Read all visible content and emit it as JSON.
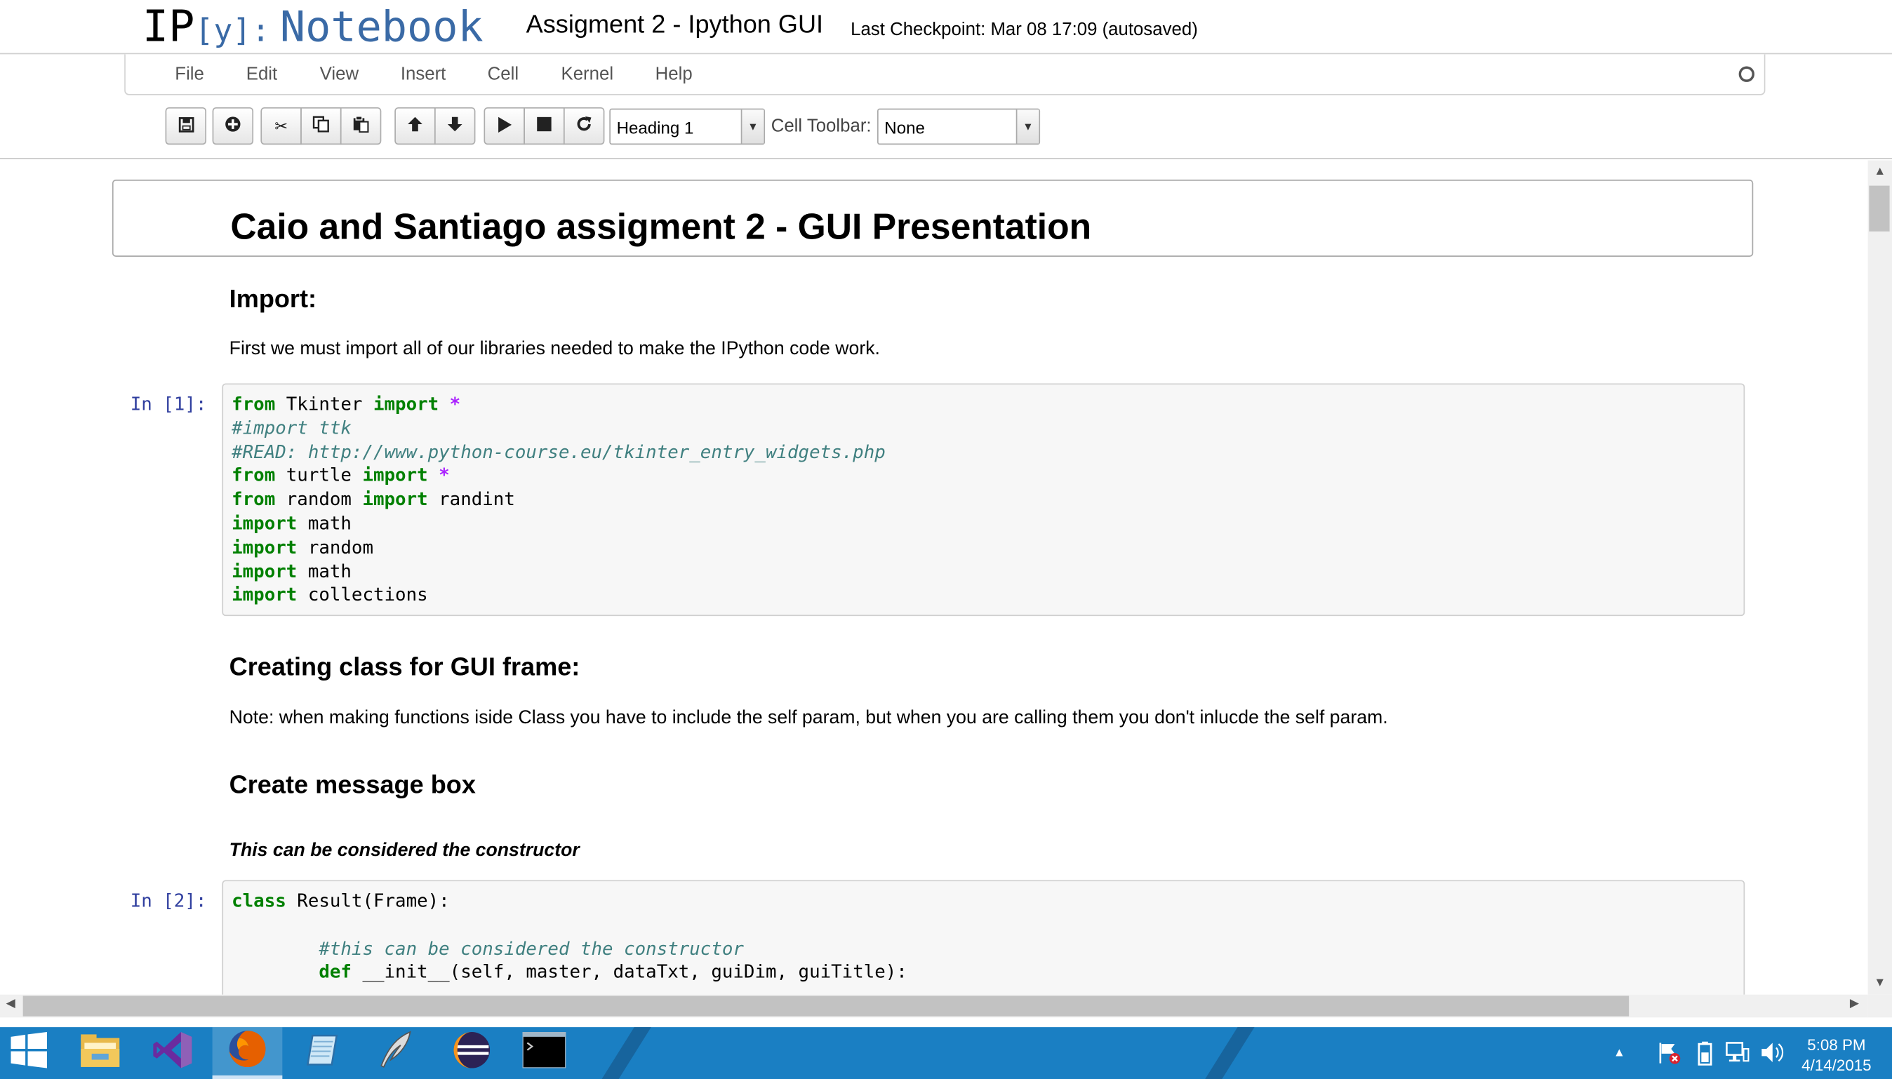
{
  "header": {
    "logo_ip": "IP",
    "logo_y": "[y]:",
    "logo_notebook": "Notebook",
    "notebook_title": "Assigment 2 - Ipython GUI",
    "checkpoint": "Last Checkpoint: Mar 08 17:09 (autosaved)"
  },
  "menu": [
    "File",
    "Edit",
    "View",
    "Insert",
    "Cell",
    "Kernel",
    "Help"
  ],
  "toolbar": {
    "cell_type_value": "Heading 1",
    "cell_toolbar_label": "Cell Toolbar:",
    "cell_toolbar_value": "None",
    "icons": [
      "save-icon",
      "insert-cell-icon",
      "cut-icon",
      "copy-icon",
      "paste-icon",
      "move-up-icon",
      "move-down-icon",
      "run-icon",
      "stop-icon",
      "restart-icon"
    ]
  },
  "notebook": {
    "h1": "Caio and Santiago assigment 2 - GUI Presentation",
    "import_heading": "Import:",
    "import_text": "First we must import all of our libraries needed to make the IPython code work.",
    "prompt1": "In [1]:",
    "code1": [
      [
        [
          "kw",
          "from"
        ],
        [
          "n",
          " Tkinter "
        ],
        [
          "kw",
          "import"
        ],
        [
          "n",
          " "
        ],
        [
          "op",
          "*"
        ]
      ],
      [
        [
          "cm",
          "#import ttk"
        ]
      ],
      [
        [
          "cm",
          "#READ: http://www.python-course.eu/tkinter_entry_widgets.php"
        ]
      ],
      [
        [
          "kw",
          "from"
        ],
        [
          "n",
          " turtle "
        ],
        [
          "kw",
          "import"
        ],
        [
          "n",
          " "
        ],
        [
          "op",
          "*"
        ]
      ],
      [
        [
          "kw",
          "from"
        ],
        [
          "n",
          " random "
        ],
        [
          "kw",
          "import"
        ],
        [
          "n",
          " randint"
        ]
      ],
      [
        [
          "kw",
          "import"
        ],
        [
          "n",
          " math"
        ]
      ],
      [
        [
          "kw",
          "import"
        ],
        [
          "n",
          " random"
        ]
      ],
      [
        [
          "kw",
          "import"
        ],
        [
          "n",
          " math"
        ]
      ],
      [
        [
          "kw",
          "import"
        ],
        [
          "n",
          " collections"
        ]
      ]
    ],
    "class_heading": "Creating class for GUI frame:",
    "note_text": "Note: when making functions iside Class you have to include the self param, but when you are calling them you don't inlucde the self param.",
    "msgbox_heading": "Create message box",
    "constructor_text": "This can be considered the constructor",
    "prompt2": "In [2]:",
    "code2": [
      [
        [
          "kw",
          "class"
        ],
        [
          "n",
          " Result(Frame):"
        ]
      ],
      [
        [
          "n",
          ""
        ]
      ],
      [
        [
          "n",
          "        "
        ],
        [
          "cm",
          "#this can be considered the constructor"
        ]
      ],
      [
        [
          "n",
          "        "
        ],
        [
          "kw",
          "def"
        ],
        [
          "n",
          " __init__(self, master, dataTxt, guiDim, guiTitle):"
        ]
      ]
    ]
  },
  "taskbar": {
    "apps": [
      "windows-start-icon",
      "file-explorer-icon",
      "visual-studio-icon",
      "firefox-icon",
      "notepad-icon",
      "quill-icon",
      "eclipse-icon",
      "command-prompt-icon"
    ],
    "time": "5:08 PM",
    "date": "4/14/2015"
  }
}
